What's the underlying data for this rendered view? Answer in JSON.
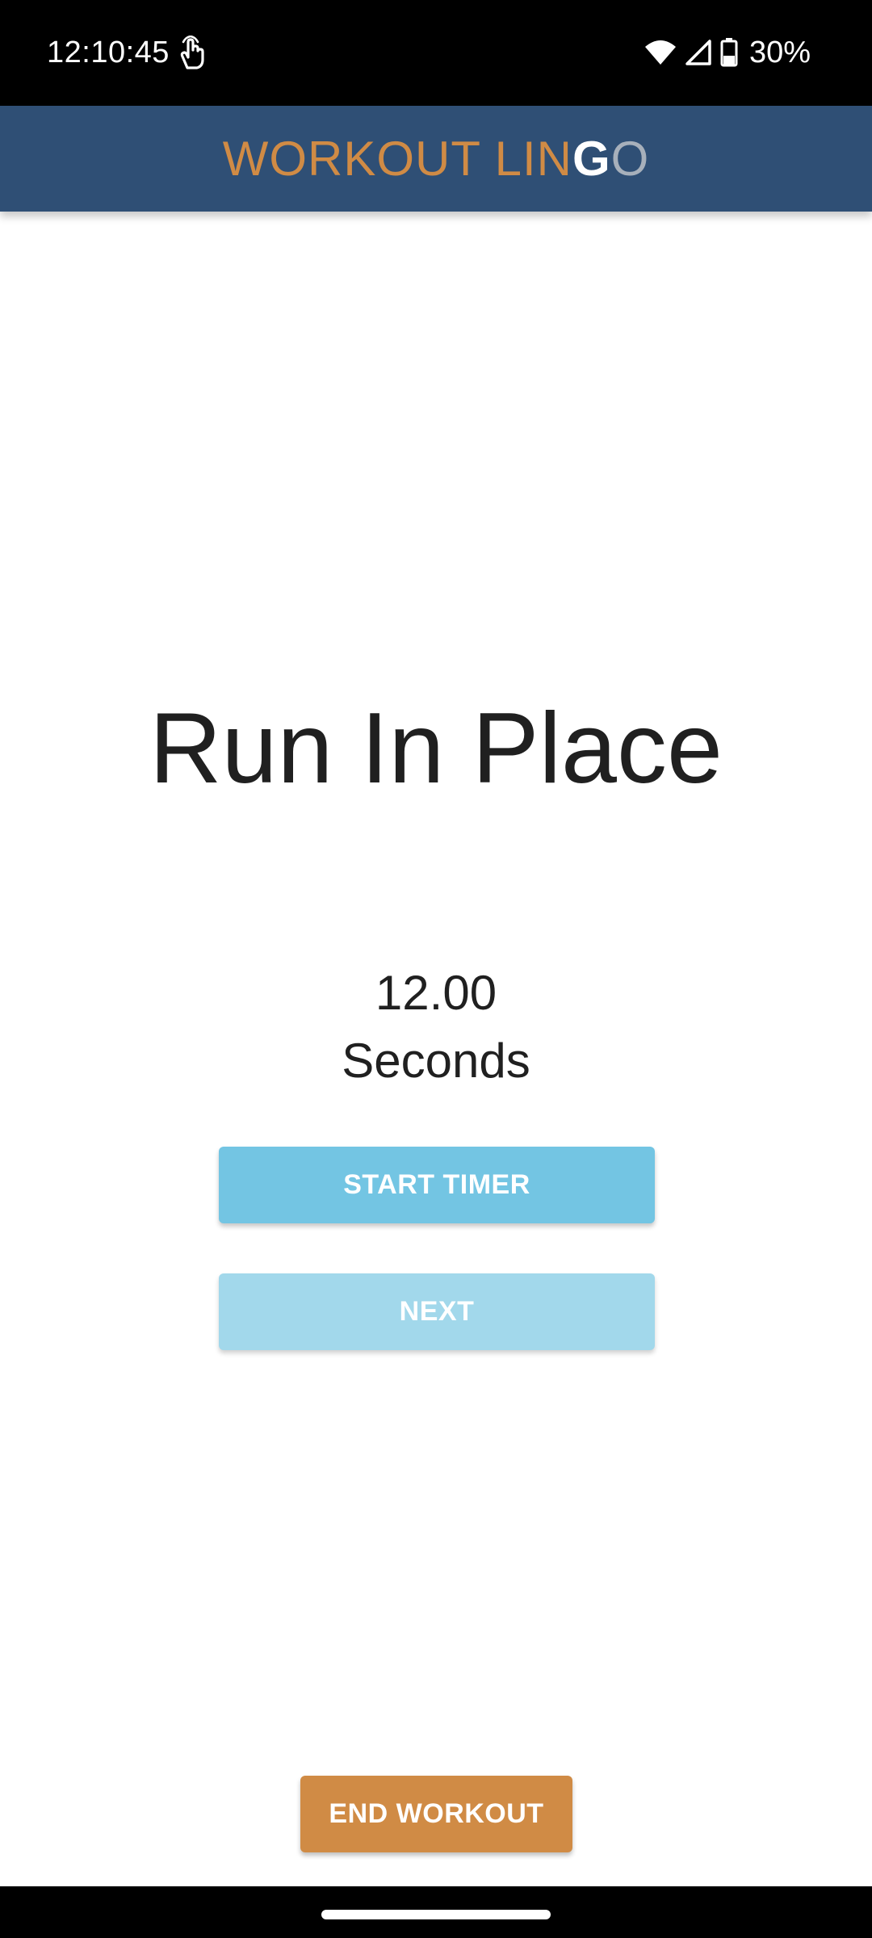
{
  "status_bar": {
    "time": "12:10:45",
    "battery_percent": "30%",
    "icons": [
      "touch-icon",
      "wifi-icon",
      "cell-signal-icon",
      "battery-icon"
    ]
  },
  "app_bar": {
    "title_parts": {
      "orange": "WORKOUT LIN",
      "white": "G",
      "grey": "O"
    },
    "colors": {
      "background": "#2f4f75",
      "orange": "#d08b45",
      "white": "#ffffff",
      "grey": "#a7b0bb"
    }
  },
  "exercise": {
    "name": "Run In Place",
    "timer_value": "12.00",
    "timer_unit": "Seconds"
  },
  "buttons": {
    "start_timer": "START TIMER",
    "next": "NEXT",
    "end_workout": "END WORKOUT"
  },
  "colors": {
    "start_button": "#73c5e3",
    "next_button": "#a2d8eb",
    "end_button": "#d08b45"
  }
}
